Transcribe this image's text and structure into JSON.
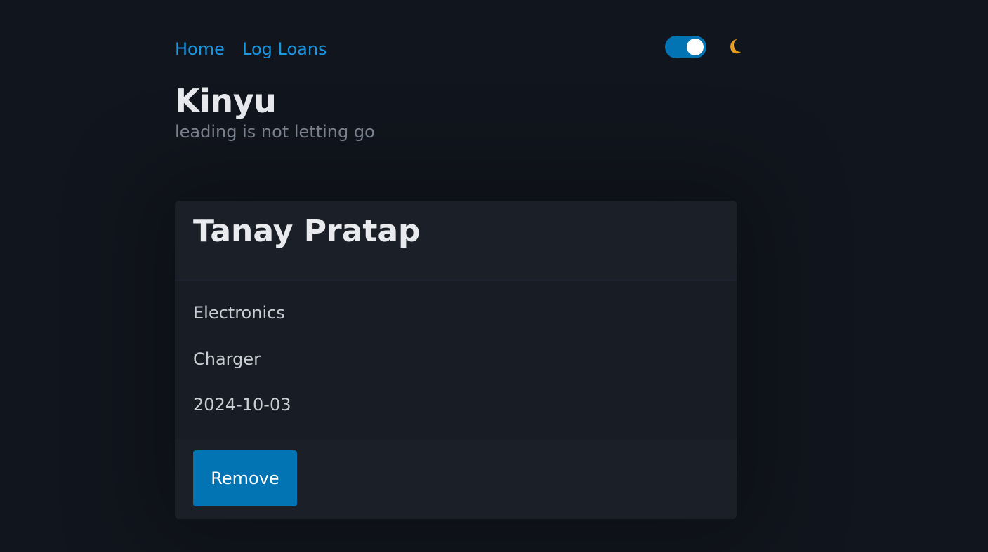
{
  "nav": {
    "home_label": "Home",
    "log_loans_label": "Log Loans"
  },
  "theme": {
    "dark_mode_on": true,
    "toggle_color": "#0274b3",
    "icon": "moon-icon"
  },
  "site": {
    "title": "Kinyu",
    "tagline": "leading is not letting go"
  },
  "loan_card": {
    "borrower_name": "Tanay Pratap",
    "category": "Electronics",
    "item": "Charger",
    "date": "2024-10-03",
    "remove_label": "Remove"
  },
  "colors": {
    "background": "#11151d",
    "card": "#181c25",
    "link": "#1a95e0",
    "accent": "#0274b3"
  }
}
